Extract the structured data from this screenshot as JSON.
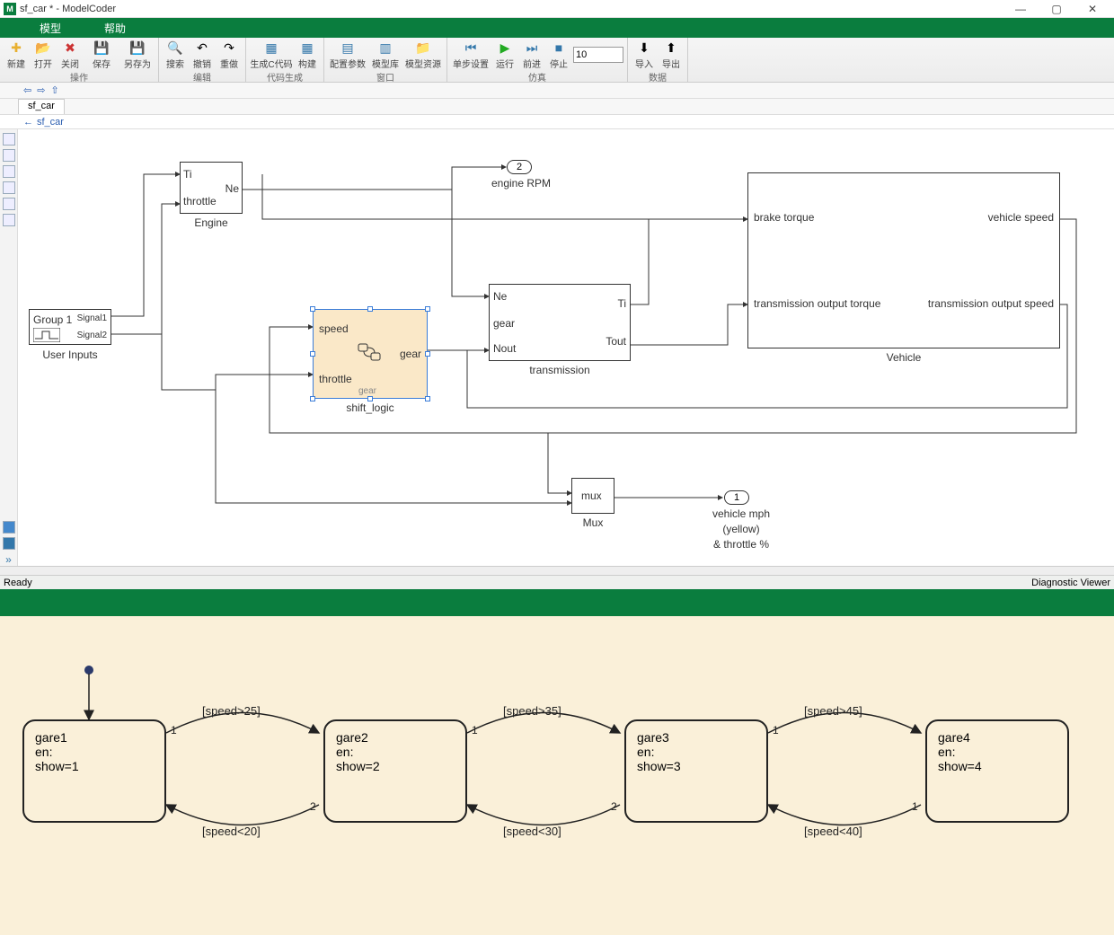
{
  "window": {
    "title": "sf_car * - ModelCoder"
  },
  "menus": {
    "model": "模型",
    "help": "帮助"
  },
  "toolbar": {
    "g_ops": "操作",
    "g_edit": "编辑",
    "g_codegen": "代码生成",
    "g_win": "窗口",
    "g_sim": "仿真",
    "g_data": "数据",
    "new": "新建",
    "open": "打开",
    "close": "关闭",
    "save": "保存",
    "saveas": "另存为",
    "search": "搜索",
    "undo": "撤销",
    "redo": "重做",
    "genc": "生成C代码",
    "build": "构建",
    "cfg": "配置参数",
    "mdllib": "模型库",
    "mdlres": "模型资源",
    "step": "单步设置",
    "run": "运行",
    "fwd": "前进",
    "stop": "停止",
    "import": "导入",
    "export": "导出",
    "simtime": "10"
  },
  "nav": {
    "back": "⇦",
    "fwd": "⇨",
    "up": "⇧"
  },
  "tab": {
    "name": "sf_car"
  },
  "crumb": {
    "path": "sf_car"
  },
  "status": {
    "ready": "Ready",
    "diag": "Diagnostic Viewer"
  },
  "blocks": {
    "userInputs": {
      "title": "Group 1",
      "s1": "Signal1",
      "s2": "Signal2",
      "label": "User Inputs"
    },
    "engine": {
      "in1": "Ti",
      "in2": "throttle",
      "out": "Ne",
      "label": "Engine"
    },
    "shift": {
      "in1": "speed",
      "in2": "throttle",
      "out": "gear",
      "sub": "gear",
      "label": "shift_logic"
    },
    "trans": {
      "in1": "Ne",
      "in2": "gear",
      "in3": "Nout",
      "out1": "Ti",
      "out2": "Tout",
      "label": "transmission"
    },
    "vehicle": {
      "in1": "brake torque",
      "in2": "transmission output torque",
      "out1": "vehicle speed",
      "out2": "transmission output speed",
      "label": "Vehicle"
    },
    "mux": {
      "txt": "mux",
      "label": "Mux"
    },
    "op2": {
      "num": "2",
      "label": "engine RPM"
    },
    "op1": {
      "num": "1",
      "l1": "vehicle mph",
      "l2": "(yellow)",
      "l3": "& throttle %"
    }
  },
  "states": {
    "s1": {
      "name": "gare1",
      "en": "en:",
      "act": "show=1"
    },
    "s2": {
      "name": "gare2",
      "en": "en:",
      "act": "show=2"
    },
    "s3": {
      "name": "gare3",
      "en": "en:",
      "act": "show=3"
    },
    "s4": {
      "name": "gare4",
      "en": "en:",
      "act": "show=4"
    },
    "t12": "[speed>25]",
    "t21": "[speed<20]",
    "t23": "[speed>35]",
    "t32": "[speed<30]",
    "t34": "[speed>45]",
    "t43": "[speed<40]",
    "one": "1",
    "two": "2"
  }
}
